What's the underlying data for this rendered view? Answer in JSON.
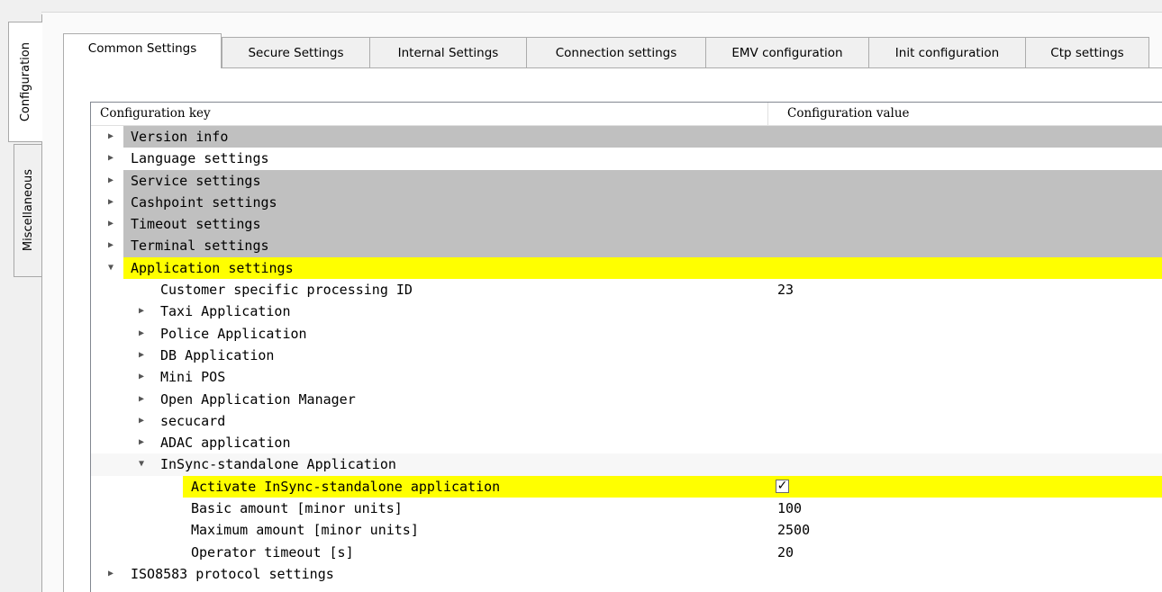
{
  "side_tabs": [
    "Configuration",
    "Miscellaneous"
  ],
  "tabs": [
    "Common Settings",
    "Secure Settings",
    "Internal Settings",
    "Connection settings",
    "EMV configuration",
    "Init configuration",
    "Ctp settings"
  ],
  "table": {
    "headers": {
      "key": "Configuration key",
      "value": "Configuration value"
    },
    "rows": [
      {
        "label": "Version info",
        "value": ""
      },
      {
        "label": "Language settings",
        "value": ""
      },
      {
        "label": "Service settings",
        "value": ""
      },
      {
        "label": "Cashpoint settings",
        "value": ""
      },
      {
        "label": "Timeout settings",
        "value": ""
      },
      {
        "label": "Terminal settings",
        "value": ""
      },
      {
        "label": "Application settings",
        "value": ""
      },
      {
        "label": "Customer specific processing ID",
        "value": "23"
      },
      {
        "label": "Taxi Application",
        "value": ""
      },
      {
        "label": "Police Application",
        "value": ""
      },
      {
        "label": "DB Application",
        "value": ""
      },
      {
        "label": "Mini POS",
        "value": ""
      },
      {
        "label": "Open Application Manager",
        "value": ""
      },
      {
        "label": "secucard",
        "value": ""
      },
      {
        "label": "ADAC application",
        "value": ""
      },
      {
        "label": "InSync-standalone Application",
        "value": ""
      },
      {
        "label": "Activate InSync-standalone application",
        "value": "✓"
      },
      {
        "label": "Basic amount [minor units]",
        "value": "100"
      },
      {
        "label": "Maximum amount [minor units]",
        "value": "2500"
      },
      {
        "label": "Operator timeout [s]",
        "value": "20"
      },
      {
        "label": "ISO8583 protocol settings",
        "value": ""
      }
    ]
  },
  "colors": {
    "highlight_yellow": "#ffff00",
    "group_gray": "#c0c0c0"
  },
  "icons": {
    "collapsed": "triangle-right",
    "expanded": "triangle-down"
  }
}
